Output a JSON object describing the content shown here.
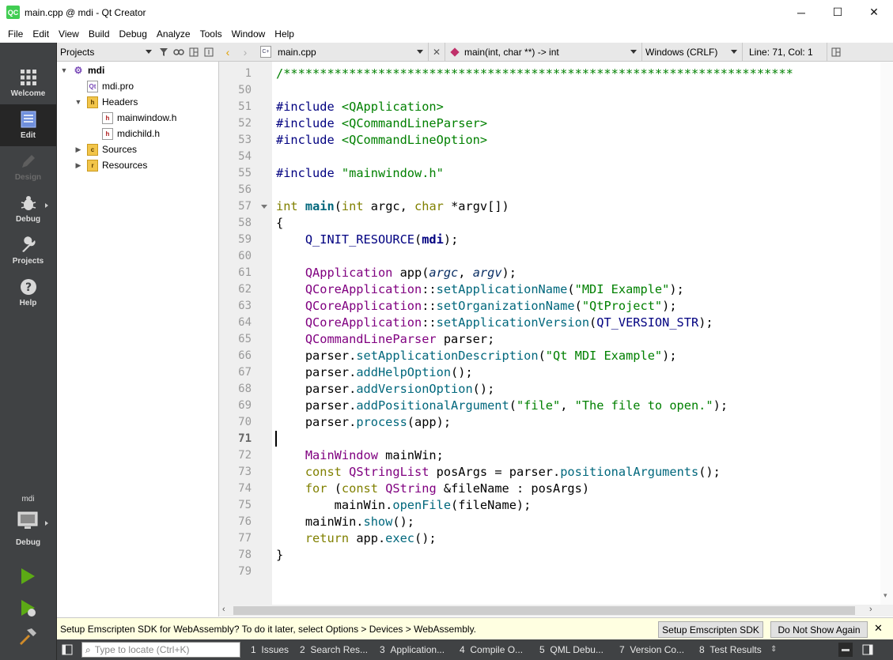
{
  "window": {
    "app_icon": "QC",
    "title": "main.cpp @ mdi - Qt Creator",
    "controls": {
      "minimize": "─",
      "maximize": "☐",
      "close": "✕"
    }
  },
  "menu": [
    "File",
    "Edit",
    "View",
    "Build",
    "Debug",
    "Analyze",
    "Tools",
    "Window",
    "Help"
  ],
  "modes": [
    {
      "label": "Welcome",
      "icon": "grid-icon",
      "state": "normal"
    },
    {
      "label": "Edit",
      "icon": "document-icon",
      "state": "active"
    },
    {
      "label": "Design",
      "icon": "pen-icon",
      "state": "disabled"
    },
    {
      "label": "Debug",
      "icon": "bug-icon",
      "state": "normal"
    },
    {
      "label": "Projects",
      "icon": "wrench-icon",
      "state": "normal"
    },
    {
      "label": "Help",
      "icon": "question-icon",
      "state": "normal"
    }
  ],
  "kit": {
    "project": "mdi",
    "label": "Debug"
  },
  "projects_panel": {
    "title": "Projects",
    "tree": [
      {
        "label": "mdi",
        "icon": "project-icon",
        "depth": 0,
        "expanded": true,
        "bold": true
      },
      {
        "label": "mdi.pro",
        "icon": "pro-file-icon",
        "depth": 1
      },
      {
        "label": "Headers",
        "icon": "folder-icon",
        "depth": 1,
        "expanded": true
      },
      {
        "label": "mainwindow.h",
        "icon": "header-file-icon",
        "depth": 2
      },
      {
        "label": "mdichild.h",
        "icon": "header-file-icon",
        "depth": 2
      },
      {
        "label": "Sources",
        "icon": "folder-icon",
        "depth": 1,
        "expanded": false
      },
      {
        "label": "Resources",
        "icon": "folder-icon",
        "depth": 1,
        "expanded": false
      }
    ]
  },
  "editor_toolbar": {
    "file": "main.cpp",
    "symbol": "main(int, char **) -> int",
    "line_endings": "Windows (CRLF)",
    "position": "Line: 71, Col: 1"
  },
  "editor": {
    "current_line": 71,
    "lines": [
      {
        "no": "1",
        "text": "/**********************************************************************"
      },
      {
        "no": "50",
        "text": ""
      },
      {
        "no": "51",
        "text": "#include <QApplication>"
      },
      {
        "no": "52",
        "text": "#include <QCommandLineParser>"
      },
      {
        "no": "53",
        "text": "#include <QCommandLineOption>"
      },
      {
        "no": "54",
        "text": ""
      },
      {
        "no": "55",
        "text": "#include \"mainwindow.h\""
      },
      {
        "no": "56",
        "text": ""
      },
      {
        "no": "57",
        "text": "int main(int argc, char *argv[])"
      },
      {
        "no": "58",
        "text": "{"
      },
      {
        "no": "59",
        "text": "    Q_INIT_RESOURCE(mdi);"
      },
      {
        "no": "60",
        "text": ""
      },
      {
        "no": "61",
        "text": "    QApplication app(argc, argv);"
      },
      {
        "no": "62",
        "text": "    QCoreApplication::setApplicationName(\"MDI Example\");"
      },
      {
        "no": "63",
        "text": "    QCoreApplication::setOrganizationName(\"QtProject\");"
      },
      {
        "no": "64",
        "text": "    QCoreApplication::setApplicationVersion(QT_VERSION_STR);"
      },
      {
        "no": "65",
        "text": "    QCommandLineParser parser;"
      },
      {
        "no": "66",
        "text": "    parser.setApplicationDescription(\"Qt MDI Example\");"
      },
      {
        "no": "67",
        "text": "    parser.addHelpOption();"
      },
      {
        "no": "68",
        "text": "    parser.addVersionOption();"
      },
      {
        "no": "69",
        "text": "    parser.addPositionalArgument(\"file\", \"The file to open.\");"
      },
      {
        "no": "70",
        "text": "    parser.process(app);"
      },
      {
        "no": "71",
        "text": ""
      },
      {
        "no": "72",
        "text": "    MainWindow mainWin;"
      },
      {
        "no": "73",
        "text": "    const QStringList posArgs = parser.positionalArguments();"
      },
      {
        "no": "74",
        "text": "    for (const QString &fileName : posArgs)"
      },
      {
        "no": "75",
        "text": "        mainWin.openFile(fileName);"
      },
      {
        "no": "76",
        "text": "    mainWin.show();"
      },
      {
        "no": "77",
        "text": "    return app.exec();"
      },
      {
        "no": "78",
        "text": "}"
      },
      {
        "no": "79",
        "text": ""
      }
    ]
  },
  "infobar": {
    "message": "Setup Emscripten SDK for WebAssembly? To do it later, select Options > Devices > WebAssembly.",
    "setup_button": "Setup Emscripten SDK",
    "dismiss_button": "Do Not Show Again",
    "close": "✕"
  },
  "statusbar": {
    "locator_placeholder": "Type to locate (Ctrl+K)",
    "panes": [
      {
        "num": "1",
        "label": "Issues"
      },
      {
        "num": "2",
        "label": "Search Res..."
      },
      {
        "num": "3",
        "label": "Application..."
      },
      {
        "num": "4",
        "label": "Compile O..."
      },
      {
        "num": "5",
        "label": "QML Debu..."
      },
      {
        "num": "7",
        "label": "Version Co..."
      },
      {
        "num": "8",
        "label": "Test Results"
      }
    ]
  },
  "colors": {
    "modebar": "#404244",
    "active_mode": "#262626",
    "run_green": "#5caa15",
    "infobar": "#ffffe1"
  }
}
